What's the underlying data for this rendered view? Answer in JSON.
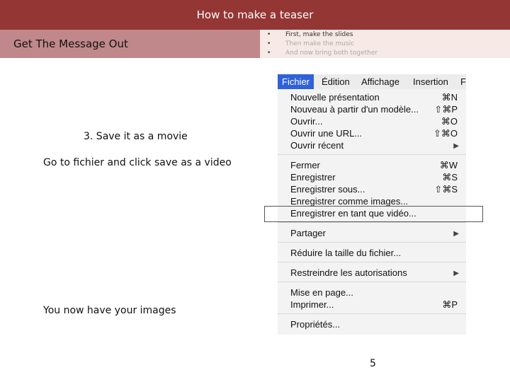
{
  "slide": {
    "title": "How to make a teaser",
    "subtitle": "Get The Message Out",
    "bullets": [
      "First, make the slides",
      "Then make the music",
      "And now bring both together"
    ],
    "step_title": "3. Save it as a movie",
    "step_desc": "Go to fichier and click save as a video",
    "step_end": "You now have your images",
    "page_number": "5"
  },
  "menu": {
    "bar": [
      "Fichier",
      "Édition",
      "Affichage",
      "Insertion",
      "F"
    ],
    "items": [
      {
        "label": "Nouvelle présentation",
        "shortcut": "⌘N"
      },
      {
        "label": "Nouveau à partir d'un modèle...",
        "shortcut": "⇧⌘P"
      },
      {
        "label": "Ouvrir...",
        "shortcut": "⌘O"
      },
      {
        "label": "Ouvrir une URL...",
        "shortcut": "⇧⌘O"
      },
      {
        "label": "Ouvrir récent",
        "shortcut": ""
      },
      {
        "label": "Fermer",
        "shortcut": "⌘W"
      },
      {
        "label": "Enregistrer",
        "shortcut": "⌘S"
      },
      {
        "label": "Enregistrer sous...",
        "shortcut": "⇧⌘S"
      },
      {
        "label": "Enregistrer comme images...",
        "shortcut": ""
      },
      {
        "label": "Enregistrer en tant que vidéo...",
        "shortcut": ""
      },
      {
        "label": "Partager",
        "shortcut": ""
      },
      {
        "label": "Réduire la taille du fichier...",
        "shortcut": ""
      },
      {
        "label": "Restreindre les autorisations",
        "shortcut": ""
      },
      {
        "label": "Mise en page...",
        "shortcut": ""
      },
      {
        "label": "Imprimer...",
        "shortcut": "⌘P"
      },
      {
        "label": "Propriétés...",
        "shortcut": ""
      }
    ]
  },
  "colors": {
    "title_bar": "#943634",
    "subtitle_bar": "#c0888a",
    "menu_highlight": "#3061d8"
  }
}
